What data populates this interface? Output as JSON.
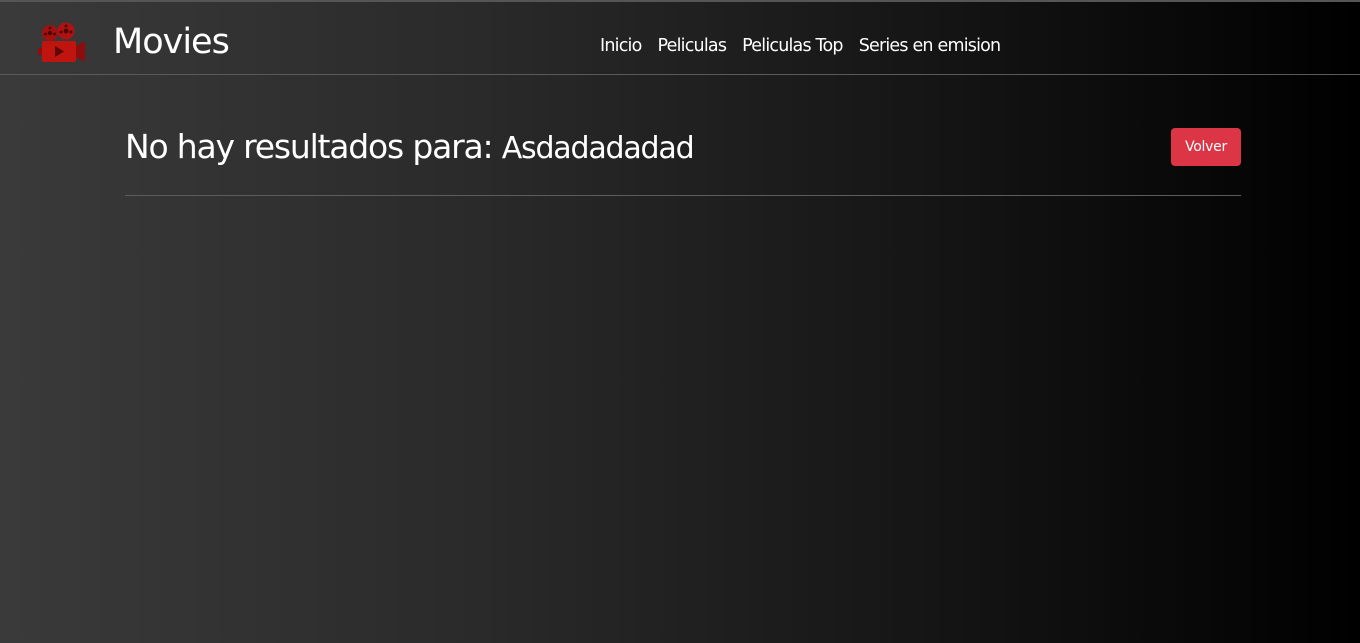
{
  "brand": {
    "title": "Movies",
    "icon": "film-projector-icon",
    "icon_color": "#c0150f"
  },
  "nav": {
    "items": [
      {
        "label": "Inicio"
      },
      {
        "label": "Peliculas"
      },
      {
        "label": "Peliculas Top"
      },
      {
        "label": "Series en emision"
      }
    ]
  },
  "main": {
    "heading_prefix": "No hay resultados para:",
    "query": "Asdadadadad",
    "back_button_label": "Volver",
    "back_button_color": "#dc3545"
  }
}
